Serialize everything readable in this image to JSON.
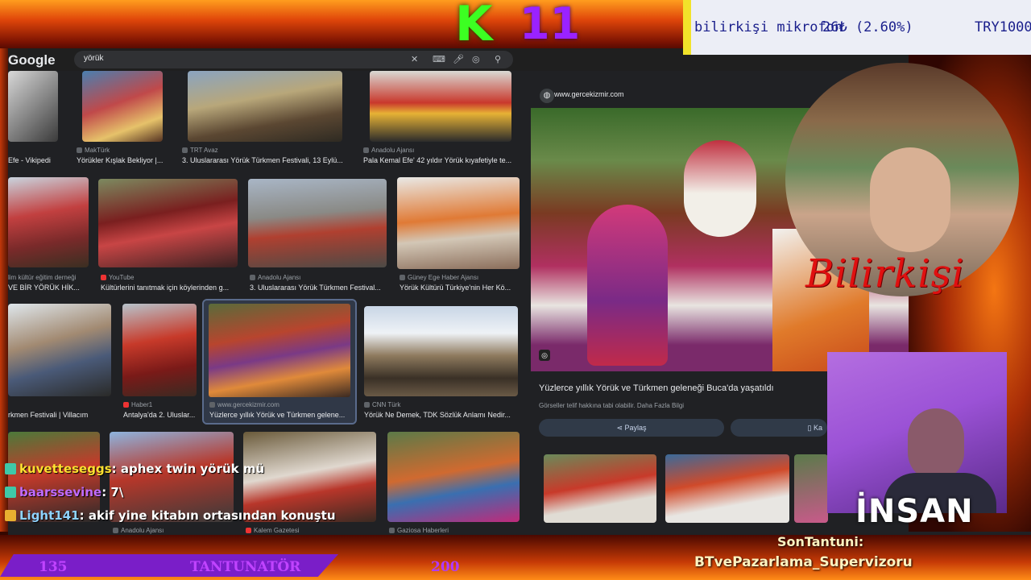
{
  "overlay": {
    "k_letter": "K",
    "k_number": "11",
    "ticker": {
      "name": "bilirkişi mikrofon",
      "price": "26₺ (2.60%)",
      "total": "TRY1000"
    },
    "cam_label": "Bilirkişi",
    "cam2_label": "İNSAN",
    "bar": {
      "left": "135",
      "name": "TANTUNATÖR",
      "right": "200"
    },
    "last_label": "SonTantuni:",
    "last_name": "BTvePazarlama_Supervizoru"
  },
  "browser": {
    "logo": "Google",
    "search_value": "yörük",
    "icons": [
      "close-icon",
      "keyboard-icon",
      "mic-icon",
      "lens-icon",
      "search-icon"
    ]
  },
  "results": [
    {
      "src": "",
      "cap": "Efe - Vikipedi"
    },
    {
      "src": "MakTürk",
      "cap": "Yörükler Kışlak Bekliyor |..."
    },
    {
      "src": "TRT Avaz",
      "cap": "3. Uluslararası Yörük Türkmen Festivali, 13 Eylü..."
    },
    {
      "src": "Anadolu Ajansı",
      "cap": "Pala Kemal Efe' 42 yıldır Yörük kıyafetiyle te..."
    },
    {
      "src": "lim kültür eğitim derneği",
      "cap": "VE BİR YÖRÜK HİK..."
    },
    {
      "src": "YouTube",
      "cap": "Kültürlerini tanıtmak için köylerinden g..."
    },
    {
      "src": "Anadolu Ajansı",
      "cap": "3. Uluslararası Yörük Türkmen Festival..."
    },
    {
      "src": "Güney Ege Haber Ajansı",
      "cap": "Yörük Kültürü Türkiye'nin Her Kö..."
    },
    {
      "src": "",
      "cap": "rkmen Festivali | Villacım"
    },
    {
      "src": "Haber1",
      "cap": "Antalya'da 2. Uluslar..."
    },
    {
      "src": "www.gercekizmir.com",
      "cap": "Yüzlerce yıllık Yörük ve Türkmen gelene..."
    },
    {
      "src": "CNN Türk",
      "cap": "Yörük Ne Demek, TDK Sözlük Anlamı Nedir..."
    },
    {
      "src": "Anadolu Ajansı",
      "cap": ""
    },
    {
      "src": "Kalem Gazetesi",
      "cap": ""
    },
    {
      "src": "Gaziosa Haberleri",
      "cap": ""
    }
  ],
  "panel": {
    "site": "www.gercekizmir.com",
    "title": "Yüzlerce yıllık Yörük ve Türkmen geleneği Buca'da yaşatıldı",
    "subtitle": "Görseller telif hakkına tabi olabilir. Daha Fazla Bilgi",
    "share": "Paylaş",
    "save": "Ka"
  },
  "chat": [
    {
      "user": "kuvetteseggs",
      "msg": ": aphex twin yörük mü",
      "color": "#ffe030"
    },
    {
      "user": "baarssevine",
      "msg": ": 7\\",
      "color": "#c06bff"
    },
    {
      "user": "Light141",
      "msg": ": akif yine kitabın ortasından konuştu",
      "color": "#8fd3ff"
    }
  ],
  "colors": {
    "k": "#3cff22",
    "eleven": "#9a22ff",
    "ticker_text": "#1a1f8c",
    "accent": "#7a1ec8"
  }
}
